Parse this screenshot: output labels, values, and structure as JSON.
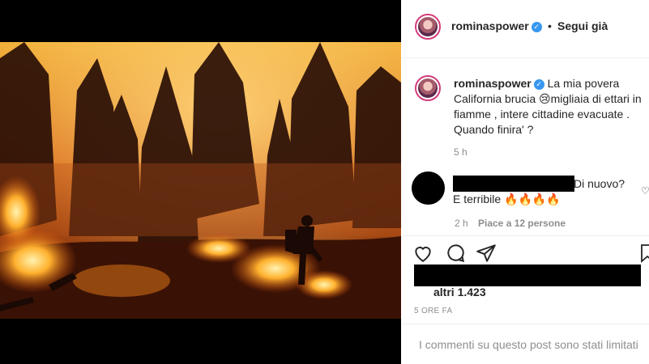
{
  "post": {
    "username": "rominaspower",
    "follow_label": "Segui già",
    "caption_text": "La mia povera California brucia 😢migliaia di ettari in fiamme , intere cittadine evacuate . Quando finira' ?",
    "caption_age": "5 h"
  },
  "comment": {
    "text_line1": "Di nuovo?",
    "text_line2": "E terribile 🔥🔥🔥🔥",
    "age": "2 h",
    "likes": "Piace a 12 persone"
  },
  "likes_text": "altri 1.423",
  "date_text": "5 ORE FA",
  "comments_disabled": "I commenti su questo post sono stati limitati",
  "icons": [
    "heart-icon",
    "comment-icon",
    "share-icon",
    "bookmark-icon",
    "verified-badge-icon"
  ],
  "colors": {
    "verified": "#3897f0",
    "meta": "#8e8e8e",
    "text": "#262626"
  }
}
